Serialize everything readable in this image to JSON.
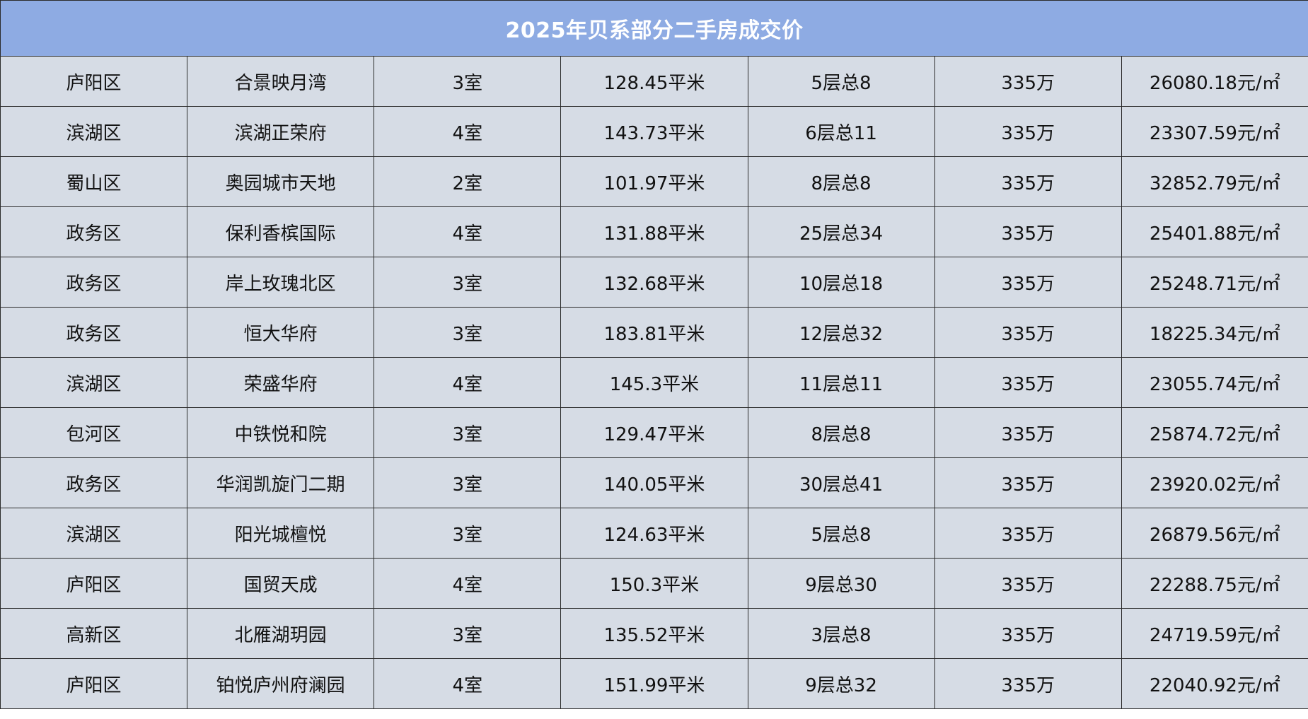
{
  "title": "2025年贝系部分二手房成交价",
  "colors": {
    "header_bg": "#8eabe3",
    "header_text": "#ffffff",
    "row_bg": "#d6dce5",
    "border": "#2b2b2b"
  },
  "rows": [
    [
      "庐阳区",
      "合景映月湾",
      "3室",
      "128.45平米",
      "5层总8",
      "335万",
      "26080.18元/㎡"
    ],
    [
      "滨湖区",
      "滨湖正荣府",
      "4室",
      "143.73平米",
      "6层总11",
      "335万",
      "23307.59元/㎡"
    ],
    [
      "蜀山区",
      "奥园城市天地",
      "2室",
      "101.97平米",
      "8层总8",
      "335万",
      "32852.79元/㎡"
    ],
    [
      "政务区",
      "保利香槟国际",
      "4室",
      "131.88平米",
      "25层总34",
      "335万",
      "25401.88元/㎡"
    ],
    [
      "政务区",
      "岸上玫瑰北区",
      "3室",
      "132.68平米",
      "10层总18",
      "335万",
      "25248.71元/㎡"
    ],
    [
      "政务区",
      "恒大华府",
      "3室",
      "183.81平米",
      "12层总32",
      "335万",
      "18225.34元/㎡"
    ],
    [
      "滨湖区",
      "荣盛华府",
      "4室",
      "145.3平米",
      "11层总11",
      "335万",
      "23055.74元/㎡"
    ],
    [
      "包河区",
      "中铁悦和院",
      "3室",
      "129.47平米",
      "8层总8",
      "335万",
      "25874.72元/㎡"
    ],
    [
      "政务区",
      "华润凯旋门二期",
      "3室",
      "140.05平米",
      "30层总41",
      "335万",
      "23920.02元/㎡"
    ],
    [
      "滨湖区",
      "阳光城檀悦",
      "3室",
      "124.63平米",
      "5层总8",
      "335万",
      "26879.56元/㎡"
    ],
    [
      "庐阳区",
      "国贸天成",
      "4室",
      "150.3平米",
      "9层总30",
      "335万",
      "22288.75元/㎡"
    ],
    [
      "高新区",
      "北雁湖玥园",
      "3室",
      "135.52平米",
      "3层总8",
      "335万",
      "24719.59元/㎡"
    ],
    [
      "庐阳区",
      "铂悦庐州府澜园",
      "4室",
      "151.99平米",
      "9层总32",
      "335万",
      "22040.92元/㎡"
    ]
  ]
}
